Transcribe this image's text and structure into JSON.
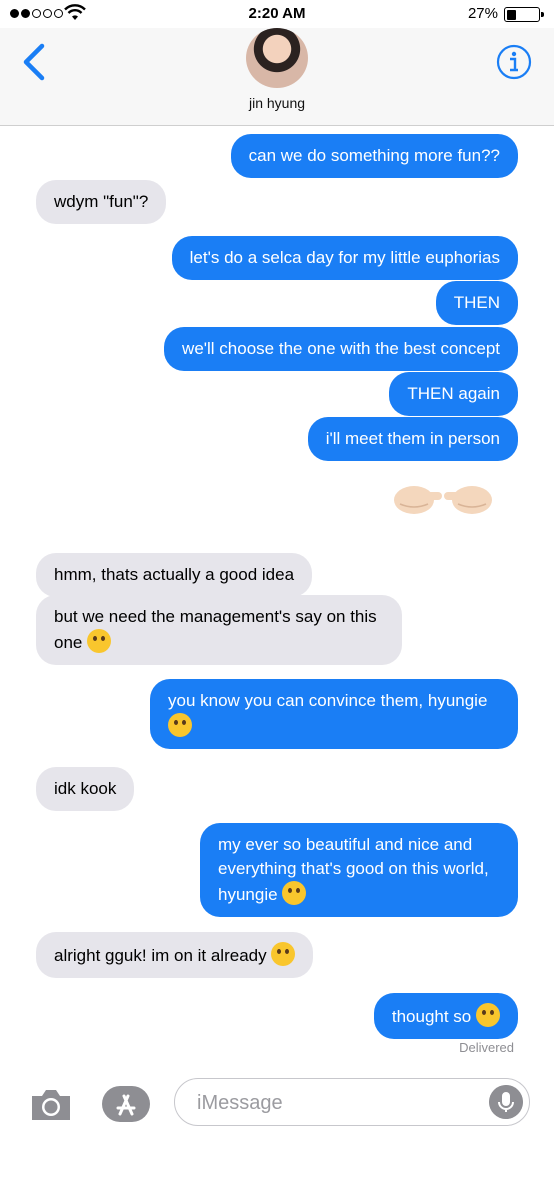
{
  "status_bar": {
    "time": "2:20 AM",
    "battery": "27%",
    "battery_level": 0.27,
    "signal_bars_filled": 2,
    "signal_bars_total": 5
  },
  "header": {
    "contact_name": "jin hyung",
    "back_icon": "chevron-left-icon",
    "info_icon": "info-icon"
  },
  "messages": [
    {
      "dir": "out",
      "text": "can we do something more fun??"
    },
    {
      "dir": "in",
      "text": "wdym \"fun\"?"
    },
    {
      "dir": "out",
      "text": "let's do a selca day for my little euphorias"
    },
    {
      "dir": "out",
      "text": "THEN"
    },
    {
      "dir": "out",
      "text": "we'll choose the one with the best concept"
    },
    {
      "dir": "out",
      "text": "THEN again"
    },
    {
      "dir": "out",
      "text": "i'll meet them in person"
    },
    {
      "dir": "out",
      "emoji": "pointing-fingers-emoji"
    },
    {
      "dir": "in",
      "text": "hmm, thats actually a good idea"
    },
    {
      "dir": "in",
      "text": "but we need the management's say on this one",
      "emoji": "thinking-face-emoji"
    },
    {
      "dir": "out",
      "text": "you know you can convince them, hyungie",
      "emoji": "sleepy-face-emoji"
    },
    {
      "dir": "in",
      "text": "idk kook"
    },
    {
      "dir": "out",
      "text": "my ever so beautiful and nice and everything that's good on this world, hyungie",
      "emoji": "kissing-face-emoji"
    },
    {
      "dir": "in",
      "text": "alright gguk! im on it already",
      "emoji": "zany-face-emoji"
    },
    {
      "dir": "out",
      "text": "thought so",
      "emoji": "eye-roll-emoji"
    }
  ],
  "delivered_label": "Delivered",
  "input": {
    "placeholder": "iMessage",
    "camera_icon": "camera-icon",
    "apps_icon": "app-store-icon",
    "mic_icon": "microphone-icon"
  },
  "colors": {
    "outgoing": "#1a7ef5",
    "incoming": "#e6e5eb",
    "accent": "#1a7ef5"
  }
}
